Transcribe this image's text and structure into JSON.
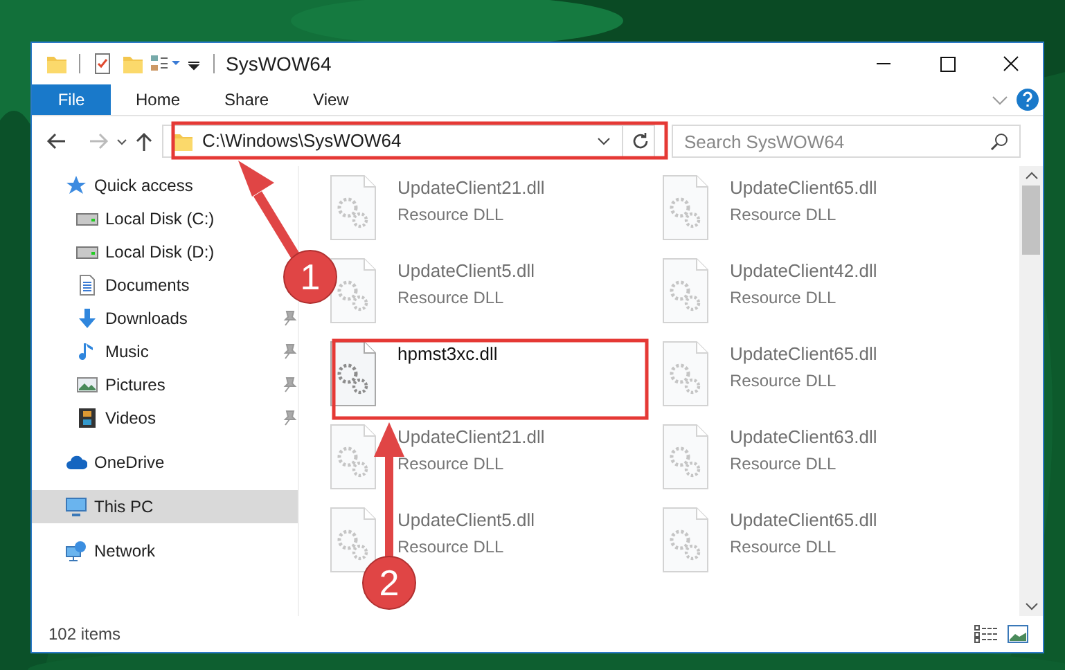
{
  "window": {
    "title": "SysWOW64"
  },
  "tabs": [
    {
      "label": "File",
      "selected": true
    },
    {
      "label": "Home",
      "selected": false
    },
    {
      "label": "Share",
      "selected": false
    },
    {
      "label": "View",
      "selected": false
    }
  ],
  "address": {
    "path": "C:\\Windows\\SysWOW64"
  },
  "search": {
    "placeholder": "Search SysWOW64"
  },
  "sidebar": {
    "items": [
      {
        "label": "Quick access",
        "kind": "star",
        "selected": false,
        "children": [
          {
            "label": "Local Disk (C:)",
            "kind": "disk"
          },
          {
            "label": "Local Disk (D:)",
            "kind": "disk"
          },
          {
            "label": "Documents",
            "kind": "document"
          },
          {
            "label": "Downloads",
            "kind": "download",
            "pinned": true
          },
          {
            "label": "Music",
            "kind": "music",
            "pinned": true
          },
          {
            "label": "Pictures",
            "kind": "pictures",
            "pinned": true
          },
          {
            "label": "Videos",
            "kind": "videos",
            "pinned": true
          }
        ]
      },
      {
        "label": "OneDrive",
        "kind": "cloud",
        "selected": false
      },
      {
        "label": "This PC",
        "kind": "pc",
        "selected": true
      },
      {
        "label": "Network",
        "kind": "network",
        "selected": false
      }
    ]
  },
  "files": [
    {
      "name": "UpdateClient21.dll",
      "description": "Resource DLL",
      "blurred": true
    },
    {
      "name": "UpdateClient65.dll",
      "description": "Resource DLL",
      "blurred": true
    },
    {
      "name": "UpdateClient5.dll",
      "description": "Resource DLL",
      "blurred": true
    },
    {
      "name": "UpdateClient42.dll",
      "description": "Resource DLL",
      "blurred": true
    },
    {
      "name": "hpmst3xc.dll",
      "blurred": false
    },
    {
      "name": "UpdateClient65.dll",
      "description": "Resource DLL",
      "blurred": true
    },
    {
      "name": "UpdateClient21.dll",
      "description": "Resource DLL",
      "blurred": true
    },
    {
      "name": "UpdateClient63.dll",
      "description": "Resource DLL",
      "blurred": true
    },
    {
      "name": "UpdateClient5.dll",
      "description": "Resource DLL",
      "blurred": true
    },
    {
      "name": "UpdateClient65.dll",
      "description": "Resource DLL",
      "blurred": true
    }
  ],
  "status_bar": {
    "count": "102 items"
  },
  "callouts": [
    {
      "number": "1"
    },
    {
      "number": "2"
    }
  ]
}
